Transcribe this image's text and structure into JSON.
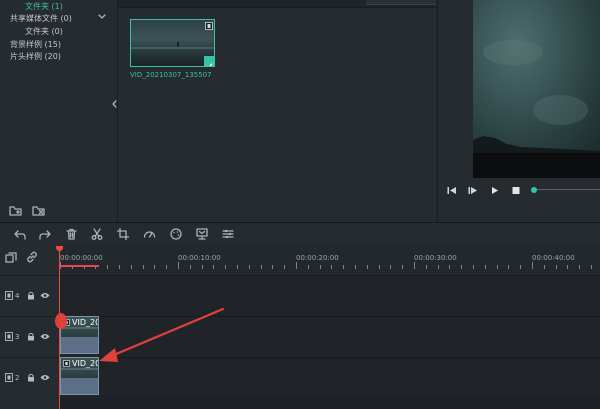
{
  "library": {
    "items": [
      {
        "label": "文件夹 (1)"
      },
      {
        "label": "共享媒体文件 (0)"
      },
      {
        "label": "文件夹 (0)"
      },
      {
        "label": "背景样例 (15)"
      },
      {
        "label": "片头样例 (20)"
      }
    ]
  },
  "media": {
    "clip_name": "VID_20210307_135507"
  },
  "timeline": {
    "ruler_labels": [
      "00:00:00:00",
      "00:00:10:00",
      "00:00:20:00",
      "00:00:30:00",
      "00:00:40:00"
    ],
    "tracks": [
      {
        "number": "4"
      },
      {
        "number": "3"
      },
      {
        "number": "2"
      }
    ],
    "clips": [
      {
        "label": "VID_20"
      },
      {
        "label": "VID_20"
      }
    ]
  },
  "colors": {
    "accent_teal": "#39c0a6",
    "playhead_red": "#e84a4a",
    "clip_blue": "#5b7088",
    "annotation_red": "#e0413a"
  }
}
